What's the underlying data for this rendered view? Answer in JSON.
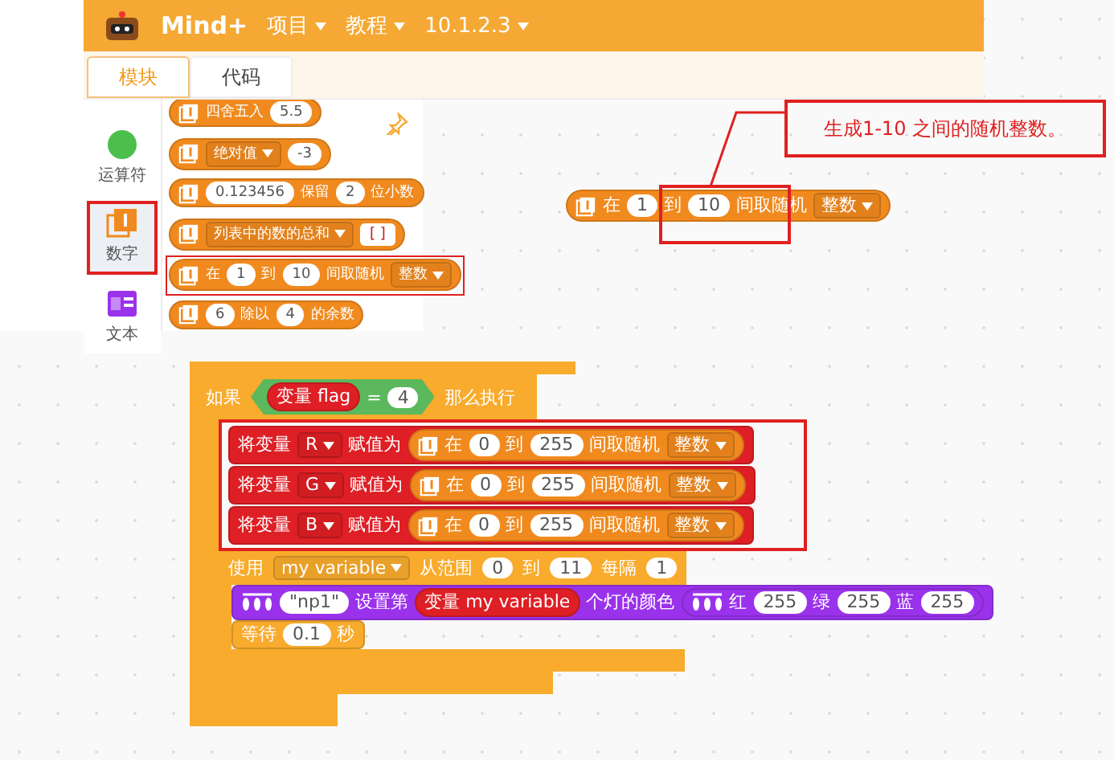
{
  "app": {
    "logo": "Mind+",
    "menu": [
      {
        "label": "项目"
      },
      {
        "label": "教程"
      },
      {
        "label": "10.1.2.3"
      }
    ],
    "tabs": [
      {
        "label": "模块",
        "selected": true
      },
      {
        "label": "代码",
        "selected": false
      }
    ]
  },
  "categories": [
    {
      "label": "运算符",
      "kind": "operators",
      "selected": false,
      "highlighted": false
    },
    {
      "label": "数字",
      "kind": "number",
      "selected": true,
      "highlighted": true
    },
    {
      "label": "文本",
      "kind": "text",
      "selected": false,
      "highlighted": false
    }
  ],
  "palette": [
    {
      "color": "#f18a1e",
      "highlighted": false,
      "parts": [
        {
          "kind": "icon"
        },
        {
          "kind": "text",
          "text": "四舍五入"
        },
        {
          "kind": "input",
          "text": "5.5"
        }
      ]
    },
    {
      "color": "#f18a1e",
      "highlighted": false,
      "parts": [
        {
          "kind": "icon"
        },
        {
          "kind": "dropdown",
          "text": "绝对值"
        },
        {
          "kind": "input",
          "text": "-3"
        }
      ]
    },
    {
      "color": "#f18a1e",
      "highlighted": false,
      "parts": [
        {
          "kind": "icon"
        },
        {
          "kind": "input",
          "text": "0.123456"
        },
        {
          "kind": "text",
          "text": "保留"
        },
        {
          "kind": "input",
          "text": "2"
        },
        {
          "kind": "text",
          "text": "位小数"
        }
      ]
    },
    {
      "color": "#f18a1e",
      "highlighted": false,
      "parts": [
        {
          "kind": "icon"
        },
        {
          "kind": "dropdown",
          "text": "列表中的数的总和"
        },
        {
          "kind": "list",
          "text": "[ ]"
        }
      ]
    },
    {
      "color": "#f18a1e",
      "highlighted": true,
      "parts": [
        {
          "kind": "icon"
        },
        {
          "kind": "text",
          "text": "在"
        },
        {
          "kind": "input",
          "text": "1"
        },
        {
          "kind": "text",
          "text": "到"
        },
        {
          "kind": "input",
          "text": "10"
        },
        {
          "kind": "text",
          "text": "间取随机"
        },
        {
          "kind": "dropdown",
          "text": "整数"
        }
      ]
    },
    {
      "color": "#f18a1e",
      "highlighted": false,
      "parts": [
        {
          "kind": "icon"
        },
        {
          "kind": "input",
          "text": "6"
        },
        {
          "kind": "text",
          "text": "除以"
        },
        {
          "kind": "input",
          "text": "4"
        },
        {
          "kind": "text",
          "text": "的余数"
        }
      ]
    }
  ],
  "callout": {
    "text": "生成1-10 之间的随机整数。"
  },
  "canvas_block": {
    "color": "#f18a1e",
    "parts": [
      {
        "kind": "icon"
      },
      {
        "kind": "text",
        "text": "在"
      },
      {
        "kind": "input",
        "text": "1"
      },
      {
        "kind": "text",
        "text": "到"
      },
      {
        "kind": "input",
        "text": "10"
      },
      {
        "kind": "text",
        "text": "间取随机"
      },
      {
        "kind": "dropdown",
        "text": "整数"
      }
    ]
  },
  "script": {
    "condition": [
      {
        "kind": "reporter",
        "color": "#de1f25",
        "parts": [
          {
            "kind": "text",
            "text": "变量 flag"
          }
        ]
      },
      {
        "kind": "text",
        "text": "="
      },
      {
        "kind": "input",
        "text": "4"
      }
    ],
    "if_label": "如果",
    "then_label": "那么执行",
    "assignments": [
      {
        "color": "#de1f25",
        "parts": [
          {
            "kind": "text",
            "text": "将变量"
          },
          {
            "kind": "dropdown",
            "text": "R"
          },
          {
            "kind": "text",
            "text": "赋值为"
          },
          {
            "kind": "reporter",
            "color": "#f18a1e",
            "parts": [
              {
                "kind": "icon"
              },
              {
                "kind": "text",
                "text": "在"
              },
              {
                "kind": "input",
                "text": "0"
              },
              {
                "kind": "text",
                "text": "到"
              },
              {
                "kind": "input",
                "text": "255"
              },
              {
                "kind": "text",
                "text": "间取随机"
              },
              {
                "kind": "dropdown",
                "text": "整数"
              }
            ]
          }
        ]
      },
      {
        "color": "#de1f25",
        "parts": [
          {
            "kind": "text",
            "text": "将变量"
          },
          {
            "kind": "dropdown",
            "text": "G"
          },
          {
            "kind": "text",
            "text": "赋值为"
          },
          {
            "kind": "reporter",
            "color": "#f18a1e",
            "parts": [
              {
                "kind": "icon"
              },
              {
                "kind": "text",
                "text": "在"
              },
              {
                "kind": "input",
                "text": "0"
              },
              {
                "kind": "text",
                "text": "到"
              },
              {
                "kind": "input",
                "text": "255"
              },
              {
                "kind": "text",
                "text": "间取随机"
              },
              {
                "kind": "dropdown",
                "text": "整数"
              }
            ]
          }
        ]
      },
      {
        "color": "#de1f25",
        "parts": [
          {
            "kind": "text",
            "text": "将变量"
          },
          {
            "kind": "dropdown",
            "text": "B"
          },
          {
            "kind": "text",
            "text": "赋值为"
          },
          {
            "kind": "reporter",
            "color": "#f18a1e",
            "parts": [
              {
                "kind": "icon"
              },
              {
                "kind": "text",
                "text": "在"
              },
              {
                "kind": "input",
                "text": "0"
              },
              {
                "kind": "text",
                "text": "到"
              },
              {
                "kind": "input",
                "text": "255"
              },
              {
                "kind": "text",
                "text": "间取随机"
              },
              {
                "kind": "dropdown",
                "text": "整数"
              }
            ]
          }
        ]
      }
    ],
    "assignments_highlighted": true,
    "loop": [
      {
        "kind": "text",
        "text": "使用"
      },
      {
        "kind": "dropdown",
        "text": "my variable"
      },
      {
        "kind": "text",
        "text": "从范围"
      },
      {
        "kind": "input",
        "text": "0"
      },
      {
        "kind": "text",
        "text": "到"
      },
      {
        "kind": "input",
        "text": "11"
      },
      {
        "kind": "text",
        "text": "每隔"
      },
      {
        "kind": "input",
        "text": "1"
      }
    ],
    "loop_body": [
      {
        "color": "#9a32ec",
        "parts": [
          {
            "kind": "strip"
          },
          {
            "kind": "input",
            "text": "\"np1\""
          },
          {
            "kind": "text",
            "text": "设置第"
          },
          {
            "kind": "reporter",
            "color": "#de1f25",
            "parts": [
              {
                "kind": "text",
                "text": "变量 my variable"
              }
            ]
          },
          {
            "kind": "text",
            "text": "个灯的颜色"
          },
          {
            "kind": "reporter",
            "color": "#9a32ec",
            "parts": [
              {
                "kind": "strip"
              },
              {
                "kind": "text",
                "text": "红"
              },
              {
                "kind": "input",
                "text": "255"
              },
              {
                "kind": "text",
                "text": "绿"
              },
              {
                "kind": "input",
                "text": "255"
              },
              {
                "kind": "text",
                "text": "蓝"
              },
              {
                "kind": "input",
                "text": "255"
              }
            ]
          }
        ]
      },
      {
        "color": "#f8ab2c",
        "parts": [
          {
            "kind": "text",
            "text": "等待"
          },
          {
            "kind": "input",
            "text": "0.1"
          },
          {
            "kind": "text",
            "text": "秒"
          }
        ]
      }
    ]
  }
}
